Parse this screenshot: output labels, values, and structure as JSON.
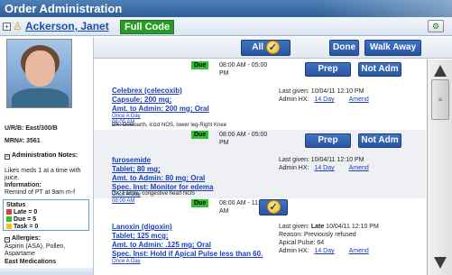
{
  "window": {
    "title": "Order Administration"
  },
  "patient": {
    "name": "Ackerson, Janet",
    "code_status": "Full Code",
    "urb": "U/R/B: East/300/B",
    "mrn": "MRN#: 3561",
    "admin_notes_title": "Administration Notes:",
    "admin_notes_text": "Likes meds 1 at a time with juice.",
    "information_title": "Information:",
    "information_text": "Remind of PT at 9am m-f",
    "status_title": "Status",
    "status_late": "Late = 0",
    "status_due": "Due = 5",
    "status_task": "Task = 0",
    "allergies_title": "Allergies:",
    "allergies_text": "Aspirin (ASA), Pollen, Aspartame",
    "east_medications": "East Medications"
  },
  "toolbar": {
    "all_label": "All",
    "done_label": "Done",
    "walk_away_label": "Walk Away"
  },
  "colors": {
    "late": "#e53a3a",
    "due": "#2fc02f",
    "task": "#f2c21d",
    "title_bar": "#3c6aa5"
  },
  "entries": [
    {
      "status": "Due",
      "time_range": "08:00 AM - 05:00 PM",
      "prep_label": "Prep",
      "not_adm_label": "Not Adm",
      "drug": "Celebrex (celecoxib)",
      "form": "Capsule; 200 mg;",
      "amount": "Amt. to Admin: 200 mg; Oral",
      "frequency": "Once A Day",
      "sched_time": "08:00 AM",
      "dx": "DX: Osteoarth, lclzd NOS, lower leg-Right Knee",
      "last_given": "Last given: 10/04/11 12:10 PM",
      "admin_hx": "Admin HX:",
      "hx_link": "14 Day",
      "amend_link": "Amend"
    },
    {
      "status": "Due",
      "time_range": "08:00 AM - 05:00 PM",
      "prep_label": "Prep",
      "not_adm_label": "Not Adm",
      "drug": "furosemide",
      "form": "Tablet; 80 mg;",
      "amount": "Amt. to Admin: 80 mg; Oral",
      "spec": "Spec. Inst: Monitor for edema",
      "frequency": "Once A Day",
      "sched_time": "08:00 AM",
      "dx": "DX: Failure, congestive heart NOS",
      "last_given": "Last given: 10/04/11 12:10 PM",
      "admin_hx": "Admin HX:",
      "hx_link": "14 Day",
      "amend_link": "Amend"
    },
    {
      "status": "Due",
      "time_range": "08:00 AM - 11:00 AM",
      "drug": "Lanoxin (digoxin)",
      "form": "Tablet; 125 mcg;",
      "amount": "Amt. to Admin: .125 mg; Oral",
      "spec": "Spec. Inst: Hold if Apical Pulse less than 60.",
      "frequency": "Once A Day",
      "last_given_prefix": "Last given:",
      "last_given_late": "Late",
      "last_given_rest": "10/04/11 12:10 PM",
      "reason": "Reason: Previously refused",
      "apical": "Apical Pulse: 64",
      "admin_hx": "Admin HX:",
      "hx_link": "14 Day",
      "amend_link": "Amend"
    }
  ]
}
